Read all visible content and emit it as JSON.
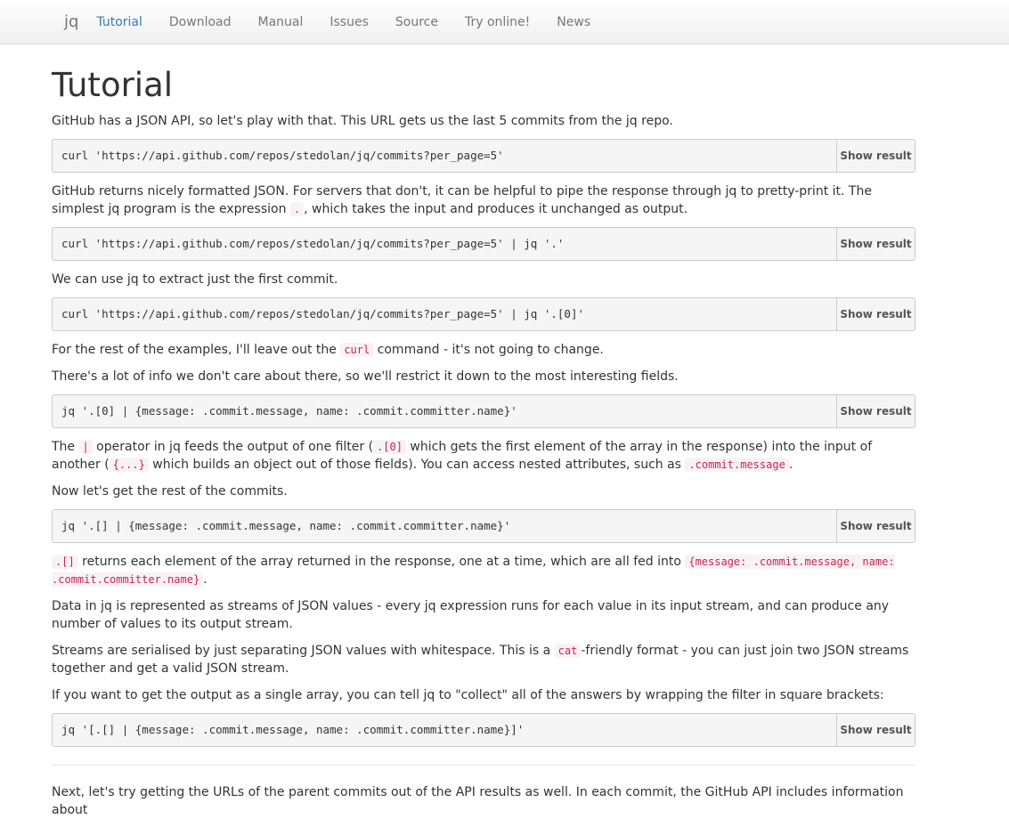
{
  "nav": {
    "brand": "jq",
    "items": [
      "Tutorial",
      "Download",
      "Manual",
      "Issues",
      "Source",
      "Try online!",
      "News"
    ]
  },
  "page": {
    "title": "Tutorial",
    "show_result": "Show result",
    "p1": "GitHub has a JSON API, so let's play with that. This URL gets us the last 5 commits from the jq repo.",
    "cmd1": "curl 'https://api.github.com/repos/stedolan/jq/commits?per_page=5'",
    "p2a": "GitHub returns nicely formatted JSON. For servers that don't, it can be helpful to pipe the response through jq to pretty-print it. The simplest jq program is the expression ",
    "p2code": ".",
    "p2b": ", which takes the input and produces it unchanged as output.",
    "cmd2": "curl 'https://api.github.com/repos/stedolan/jq/commits?per_page=5' | jq '.'",
    "p3": "We can use jq to extract just the first commit.",
    "cmd3": "curl 'https://api.github.com/repos/stedolan/jq/commits?per_page=5' | jq '.[0]'",
    "p4a": "For the rest of the examples, I'll leave out the ",
    "p4code": "curl",
    "p4b": " command - it's not going to change.",
    "p5": "There's a lot of info we don't care about there, so we'll restrict it down to the most interesting fields.",
    "cmd4": "jq '.[0] | {message: .commit.message, name: .commit.committer.name}'",
    "p6a": "The ",
    "p6code1": "|",
    "p6b": " operator in jq feeds the output of one filter (",
    "p6code2": ".[0]",
    "p6c": " which gets the first element of the array in the response) into the input of another (",
    "p6code3": "{...}",
    "p6d": " which builds an object out of those fields). You can access nested attributes, such as ",
    "p6code4": ".commit.message",
    "p6e": ".",
    "p7": "Now let's get the rest of the commits.",
    "cmd5": "jq '.[] | {message: .commit.message, name: .commit.committer.name}'",
    "p8code1": ".[]",
    "p8a": " returns each element of the array returned in the response, one at a time, which are all fed into ",
    "p8code2": "{message: .commit.message, name: .commit.committer.name}",
    "p8b": ".",
    "p9": "Data in jq is represented as streams of JSON values - every jq expression runs for each value in its input stream, and can produce any number of values to its output stream.",
    "p10a": "Streams are serialised by just separating JSON values with whitespace. This is a ",
    "p10code": "cat",
    "p10b": "-friendly format - you can just join two JSON streams together and get a valid JSON stream.",
    "p11": "If you want to get the output as a single array, you can tell jq to \"collect\" all of the answers by wrapping the filter in square brackets:",
    "cmd6": "jq '[.[] | {message: .commit.message, name: .commit.committer.name}]'",
    "p12": "Next, let's try getting the URLs of the parent commits out of the API results as well. In each commit, the GitHub API includes information about"
  }
}
